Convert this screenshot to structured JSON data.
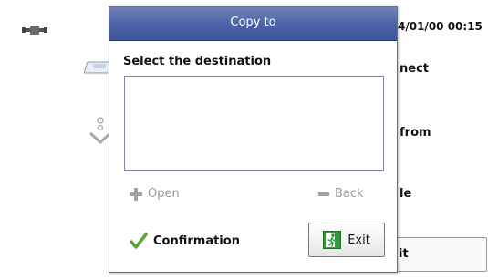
{
  "background": {
    "datetime": "4/01/00 00:15",
    "menu_labels": [
      "nect",
      "from",
      "le"
    ],
    "exit_label": "it",
    "connector_icon": "connector-icon",
    "tray_icon": "paper-tray-icon",
    "arrow_icon": "down-arrow-icon"
  },
  "dialog": {
    "title": "Copy to",
    "prompt": "Select the destination",
    "destinations": [],
    "open_label": "Open",
    "back_label": "Back",
    "confirmation_label": "Confirmation",
    "exit_label": "Exit",
    "title_color": "#4a62a5",
    "confirm_check_color": "#5aa53a",
    "exit_icon_color": "#2e9b3a"
  }
}
